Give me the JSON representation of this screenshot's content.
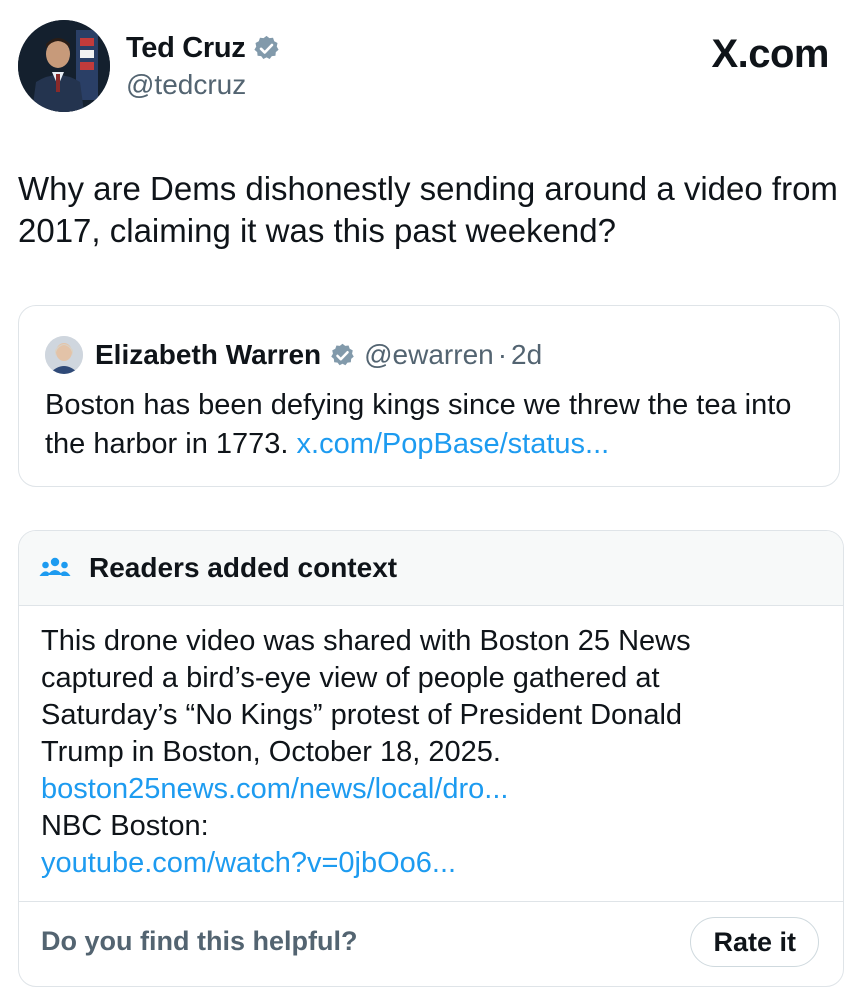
{
  "tweet": {
    "author_name": "Ted Cruz",
    "author_handle": "@tedcruz",
    "text": "Why are Dems dishonestly sending around a video from 2017, claiming it was this past weekend?"
  },
  "brand": "X.com",
  "quoted": {
    "author_name": "Elizabeth Warren",
    "author_handle": "@ewarren",
    "separator": "·",
    "time": "2d",
    "text": "Boston has been defying kings since we threw the tea into the harbor in 1773. ",
    "link": "x.com/PopBase/status..."
  },
  "community_note": {
    "title": "Readers added context",
    "body_lines": [
      "This drone video was shared with Boston 25 News",
      "captured a bird’s-eye view of people gathered at",
      "Saturday’s “No Kings” protest of President Donald",
      "Trump in Boston, October 18, 2025."
    ],
    "link1": "boston25news.com/news/local/dro...",
    "label2": "NBC Boston:",
    "link2": "youtube.com/watch?v=0jbOo6...",
    "helpful_question": "Do you find this helpful?",
    "rate_button": "Rate it"
  },
  "colors": {
    "link": "#1d9bf0",
    "secondary_text": "#536471",
    "verified_badge": "#829aab",
    "note_header_bg": "#f7f9f9"
  },
  "icons": {
    "verified": "verified-badge-icon",
    "readers": "people-group-icon"
  }
}
